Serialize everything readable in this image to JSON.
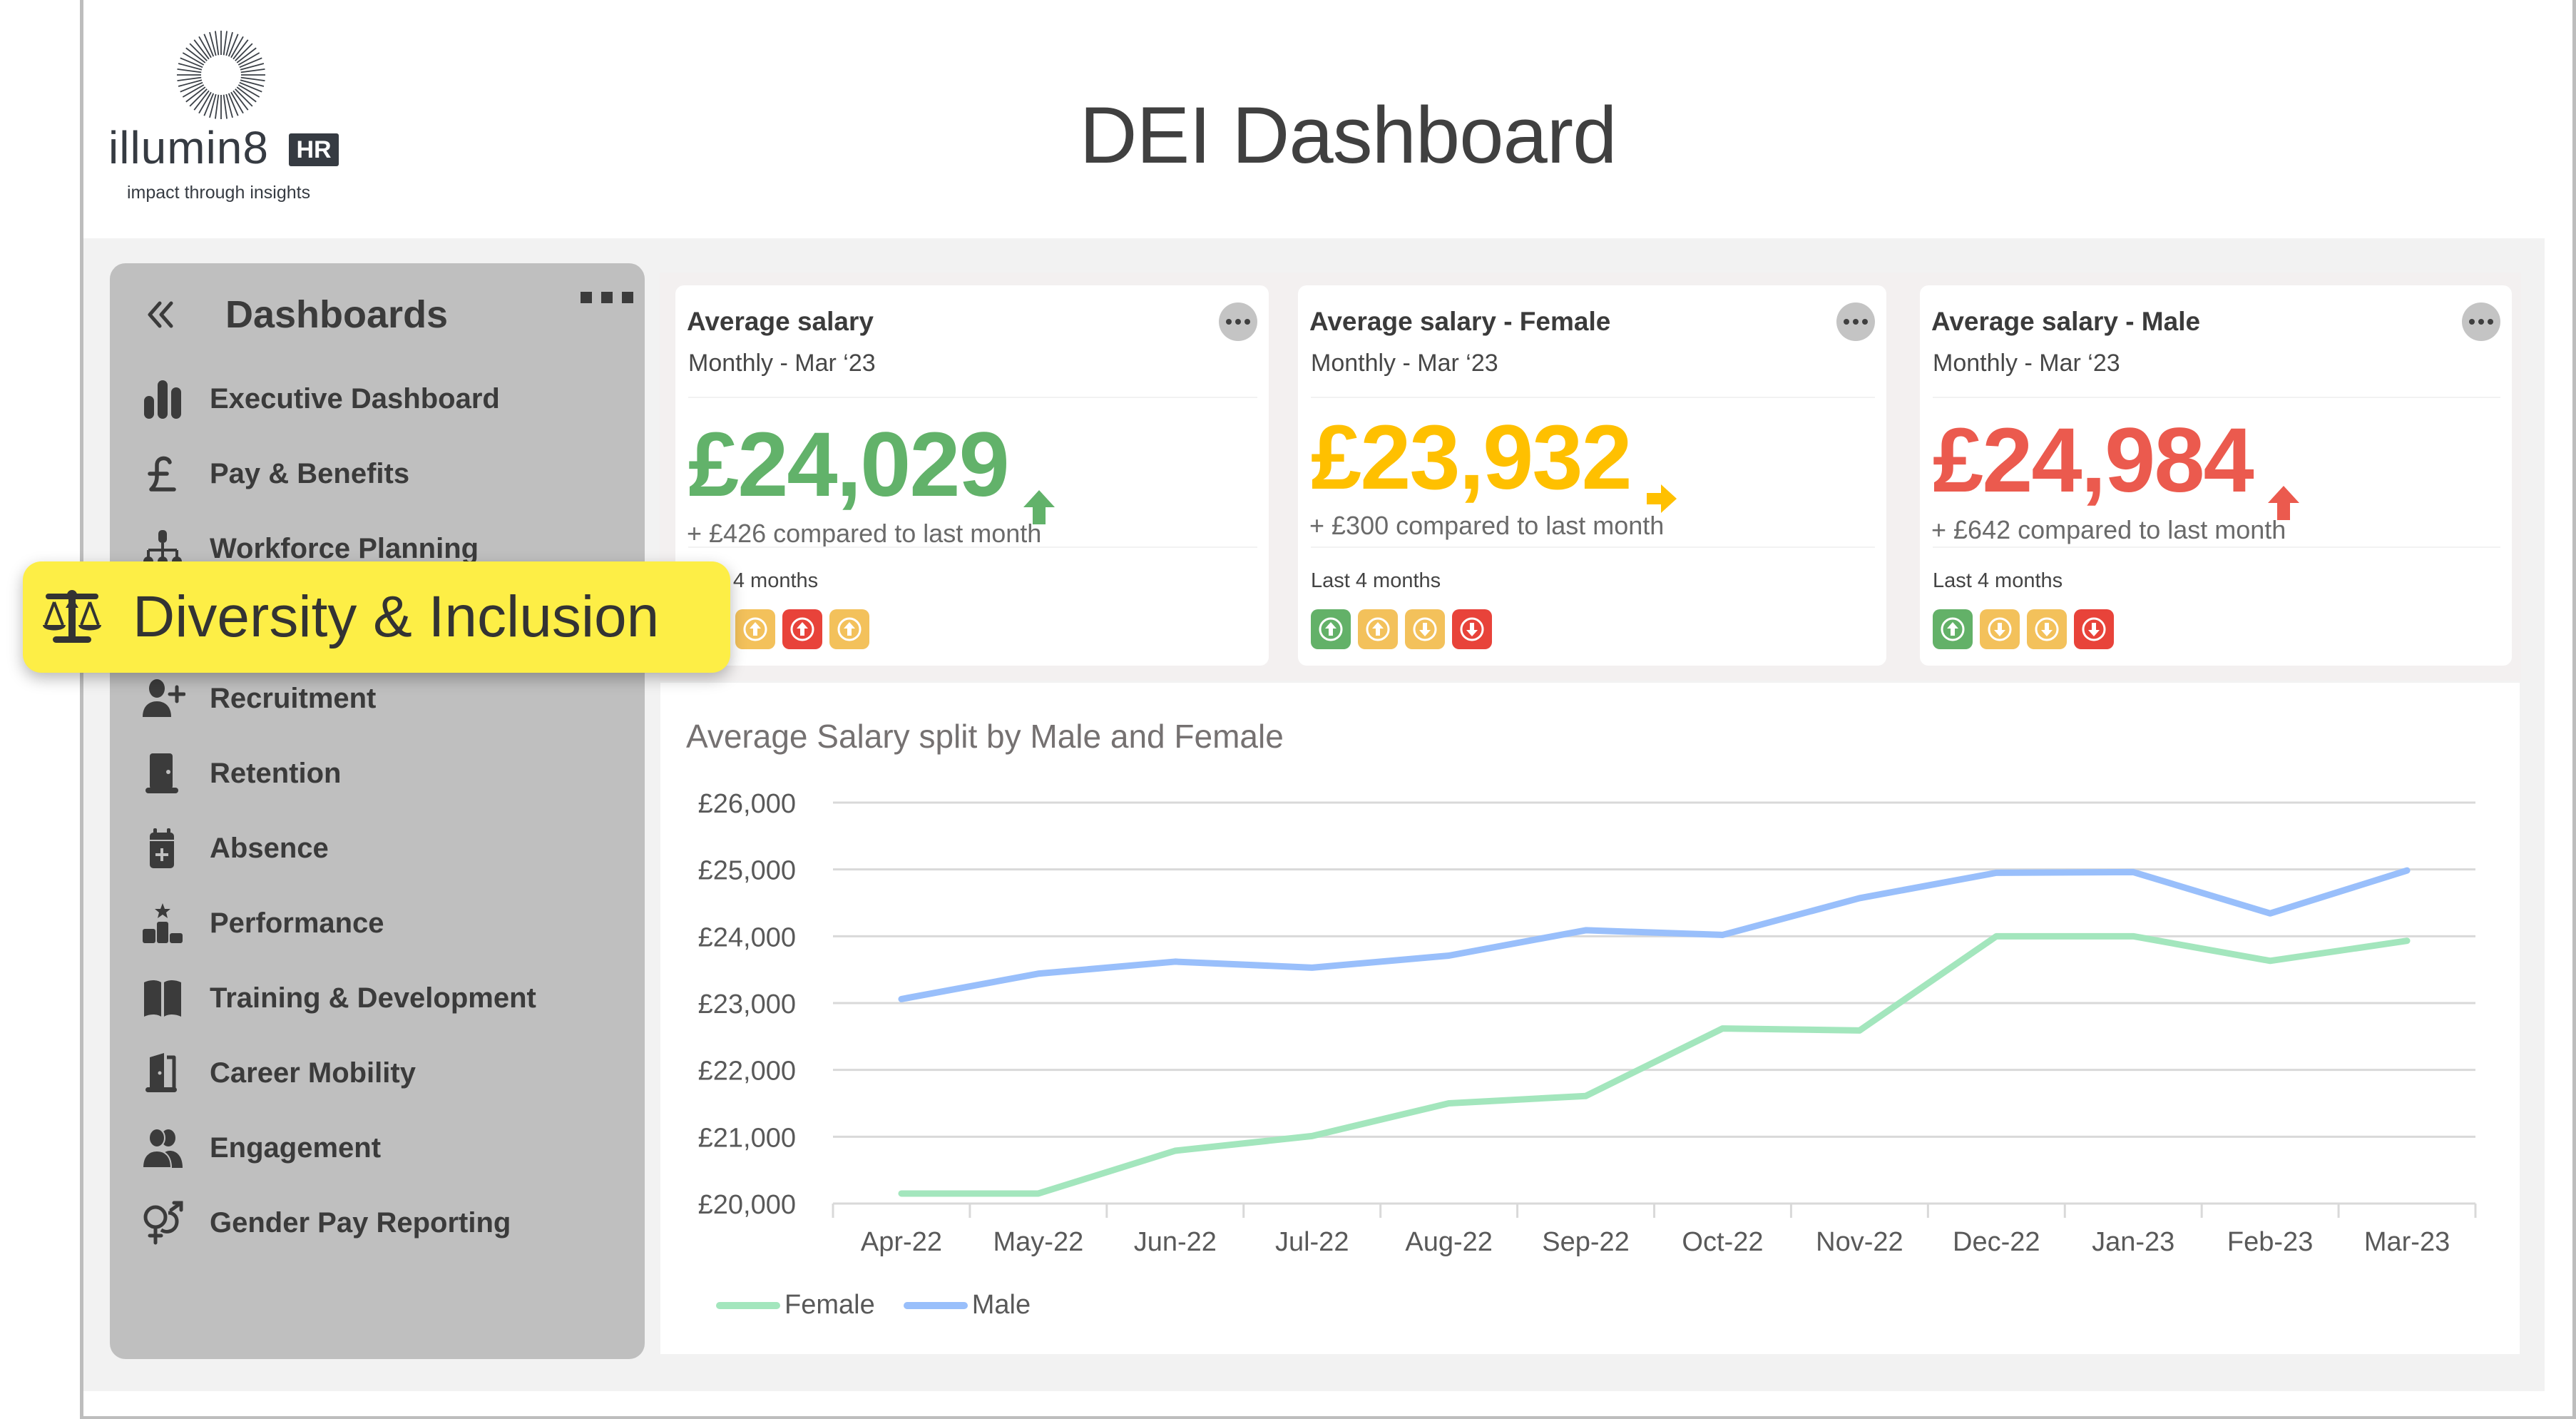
{
  "header": {
    "logo_word": "illumin8",
    "logo_badge": "HR",
    "logo_tagline": "impact through insights",
    "title": "DEI Dashboard"
  },
  "sidebar": {
    "title": "Dashboards",
    "collapse_icon": "double-chevron-left-icon",
    "more_icon": "ellipsis-icon",
    "items": [
      {
        "label": "Executive Dashboard",
        "icon": "bar-chart-icon"
      },
      {
        "label": "Pay & Benefits",
        "icon": "pound-sign-icon"
      },
      {
        "label": "Workforce Planning",
        "icon": "org-chart-icon"
      },
      {
        "label": "Diversity & Inclusion",
        "icon": "balance-scale-icon",
        "active": true
      },
      {
        "label": "Recruitment",
        "icon": "user-plus-icon"
      },
      {
        "label": "Retention",
        "icon": "door-icon"
      },
      {
        "label": "Absence",
        "icon": "calendar-plus-icon"
      },
      {
        "label": "Performance",
        "icon": "podium-star-icon"
      },
      {
        "label": "Training & Development",
        "icon": "open-book-icon"
      },
      {
        "label": "Career Mobility",
        "icon": "door-open-icon"
      },
      {
        "label": "Engagement",
        "icon": "users-icon"
      },
      {
        "label": "Gender Pay Reporting",
        "icon": "gender-symbols-icon"
      }
    ]
  },
  "highlight": {
    "label": "Diversity & Inclusion",
    "color": "#fdee46"
  },
  "kpis": [
    {
      "title": "Average salary",
      "subtitle": "Monthly - Mar ‘23",
      "value": "£24,029",
      "trend": "up",
      "color": "#62b26a",
      "delta": "+ £426 compared to last month",
      "history_label": "Last 4 months",
      "history": [
        {
          "status": "amber",
          "direction": "up"
        },
        {
          "status": "amber",
          "direction": "up"
        },
        {
          "status": "red",
          "direction": "up"
        },
        {
          "status": "amber",
          "direction": "up"
        }
      ]
    },
    {
      "title": "Average salary - Female",
      "subtitle": "Monthly - Mar ‘23",
      "value": "£23,932",
      "trend": "right",
      "color": "#ffc000",
      "delta": "+ £300 compared to last month",
      "history_label": "Last 4 months",
      "history": [
        {
          "status": "green",
          "direction": "up"
        },
        {
          "status": "amber",
          "direction": "up"
        },
        {
          "status": "amber",
          "direction": "down"
        },
        {
          "status": "red",
          "direction": "down"
        }
      ]
    },
    {
      "title": "Average salary - Male",
      "subtitle": "Monthly - Mar ‘23",
      "value": "£24,984",
      "trend": "up",
      "color": "#eb5a4e",
      "delta": "+ £642 compared to last month",
      "history_label": "Last 4 months",
      "history": [
        {
          "status": "green",
          "direction": "up"
        },
        {
          "status": "amber",
          "direction": "down"
        },
        {
          "status": "amber",
          "direction": "down"
        },
        {
          "status": "red",
          "direction": "down"
        }
      ]
    }
  ],
  "status_colors": {
    "green": "#63b168",
    "amber": "#f3c15b",
    "red": "#e8433a"
  },
  "chart_data": {
    "type": "line",
    "title": "Average Salary split by Male and Female",
    "xlabel": "",
    "ylabel": "",
    "categories": [
      "Apr-22",
      "May-22",
      "Jun-22",
      "Jul-22",
      "Aug-22",
      "Sep-22",
      "Oct-22",
      "Nov-22",
      "Dec-22",
      "Jan-23",
      "Feb-23",
      "Mar-23"
    ],
    "series": [
      {
        "name": "Female",
        "color": "#a3e6bd",
        "values": [
          20150,
          20150,
          20790,
          21010,
          21500,
          21610,
          22620,
          22590,
          24000,
          24000,
          23632,
          23932
        ]
      },
      {
        "name": "Male",
        "color": "#99bffb",
        "values": [
          23060,
          23440,
          23620,
          23530,
          23710,
          24090,
          24020,
          24570,
          24950,
          24960,
          24342,
          24984
        ]
      }
    ],
    "ylim": [
      20000,
      26000
    ],
    "yticks": [
      20000,
      21000,
      22000,
      23000,
      24000,
      25000,
      26000
    ],
    "ytick_labels": [
      "£20,000",
      "£21,000",
      "£22,000",
      "£23,000",
      "£24,000",
      "£25,000",
      "£26,000"
    ],
    "grid": true,
    "legend": "bottom-left"
  }
}
